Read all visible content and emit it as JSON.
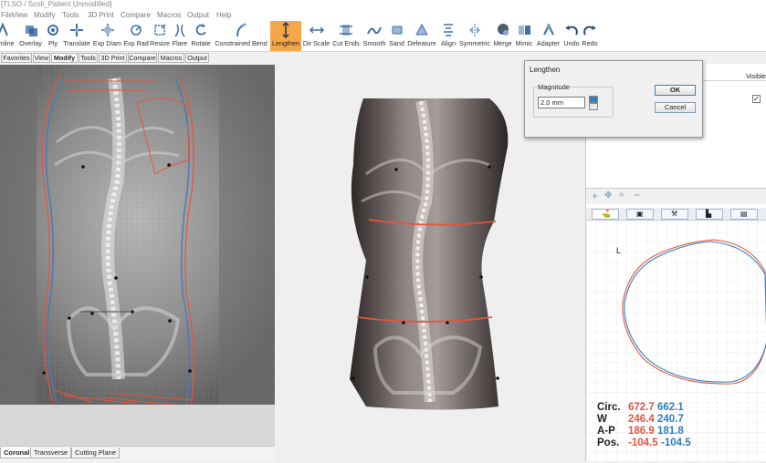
{
  "window": {
    "title": "[TLSO / Scoli_Patient Unmodified]"
  },
  "menu": [
    "File",
    "View",
    "Modify",
    "Tools",
    "3D Print",
    "Compare",
    "Macros",
    "Output",
    "Help"
  ],
  "toolbar": {
    "items": [
      {
        "label": "Trimline",
        "icon": "trimline-icon"
      },
      {
        "label": "Overlay",
        "icon": "overlay-icon"
      },
      {
        "label": "Ply",
        "icon": "ply-icon"
      },
      {
        "label": "Translate",
        "icon": "translate-icon"
      },
      {
        "label": "Exp Diam",
        "icon": "expand-diameter-icon"
      },
      {
        "label": "Exp Rad",
        "icon": "expand-radius-icon"
      },
      {
        "label": "Resize",
        "icon": "resize-icon"
      },
      {
        "label": "Flare",
        "icon": "flare-icon"
      },
      {
        "label": "Rotate",
        "icon": "rotate-icon"
      },
      {
        "label": "Constrained Bend",
        "icon": "constrained-bend-icon"
      },
      {
        "label": "Lengthen",
        "icon": "lengthen-icon"
      },
      {
        "label": "Dir Scale",
        "icon": "dir-scale-icon"
      },
      {
        "label": "Cut Ends",
        "icon": "cut-ends-icon"
      },
      {
        "label": "Smooth",
        "icon": "smooth-icon"
      },
      {
        "label": "Sand",
        "icon": "sand-icon"
      },
      {
        "label": "Defeature",
        "icon": "defeature-icon"
      },
      {
        "label": "Align",
        "icon": "align-icon"
      },
      {
        "label": "Symmetric",
        "icon": "symmetric-icon"
      },
      {
        "label": "Merge",
        "icon": "merge-icon"
      },
      {
        "label": "Mimic",
        "icon": "mimic-icon"
      },
      {
        "label": "Adapter",
        "icon": "adapter-icon"
      },
      {
        "label": "Undo",
        "icon": "undo-icon"
      },
      {
        "label": "Redo",
        "icon": "redo-icon"
      }
    ],
    "active": "Lengthen"
  },
  "ribbon_tabs": [
    "Favorites",
    "View",
    "Modify",
    "Tools",
    "3D Print",
    "Compare",
    "Macros",
    "Output"
  ],
  "ribbon_selected": "Modify",
  "view_tabs": [
    "Coronal",
    "Transverse",
    "Cutting Plane"
  ],
  "view_selected": "Coronal",
  "dialog": {
    "title": "Lengthen",
    "group_label": "Magnitude",
    "value": "2.0 mm",
    "ok_label": "OK",
    "cancel_label": "Cancel"
  },
  "layers": {
    "visible_header": "Visible",
    "row_checked": true
  },
  "cross_section": {
    "marker": "L",
    "stats": [
      {
        "label": "Circ.",
        "a": "672.7",
        "b": "662.1"
      },
      {
        "label": "W",
        "a": "246.4",
        "b": "240.7"
      },
      {
        "label": "A-P",
        "a": "186.9",
        "b": "181.8"
      },
      {
        "label": "Pos.",
        "a": "-104.5",
        "b": "-104.5"
      }
    ]
  },
  "colors": {
    "accent": "#f5a646",
    "series_a": "#e5543f",
    "series_b": "#2f7fc0"
  }
}
